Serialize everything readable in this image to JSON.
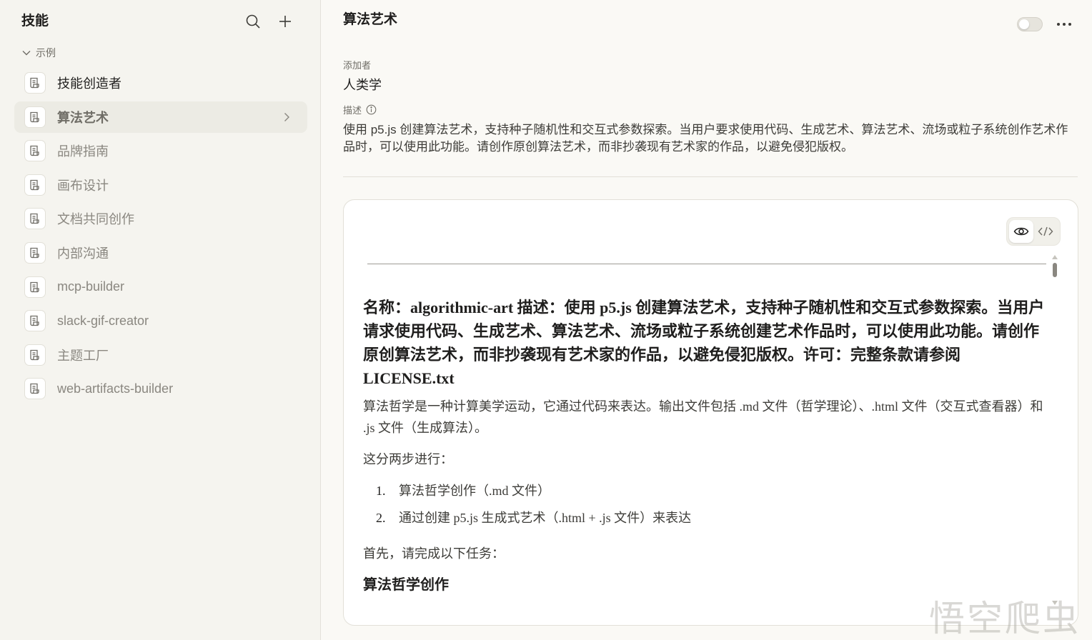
{
  "sidebar": {
    "title": "技能",
    "group_label": "示例",
    "items": [
      {
        "label": "技能创造者",
        "enabled": true,
        "active": false
      },
      {
        "label": "算法艺术",
        "enabled": false,
        "active": true
      },
      {
        "label": "品牌指南",
        "enabled": false,
        "active": false
      },
      {
        "label": "画布设计",
        "enabled": false,
        "active": false
      },
      {
        "label": "文档共同创作",
        "enabled": false,
        "active": false
      },
      {
        "label": "内部沟通",
        "enabled": false,
        "active": false
      },
      {
        "label": "mcp-builder",
        "enabled": false,
        "active": false
      },
      {
        "label": "slack-gif-creator",
        "enabled": false,
        "active": false
      },
      {
        "label": "主题工厂",
        "enabled": false,
        "active": false
      },
      {
        "label": "web-artifacts-builder",
        "enabled": false,
        "active": false
      }
    ]
  },
  "main": {
    "title": "算法艺术",
    "toggle_enabled": false,
    "added_by_label": "添加者",
    "added_by_value": "人类学",
    "description_label": "描述",
    "description": "使用 p5.js 创建算法艺术，支持种子随机性和交互式参数探索。当用户要求使用代码、生成艺术、算法艺术、流场或粒子系统创作艺术作品时，可以使用此功能。请创作原创算法艺术，而非抄袭现有艺术家的作品，以避免侵犯版权。",
    "view_mode": "preview"
  },
  "document": {
    "heading": "名称：algorithmic-art 描述：使用 p5.js 创建算法艺术，支持种子随机性和交互式参数探索。当用户请求使用代码、生成艺术、算法艺术、流场或粒子系统创建艺术作品时，可以使用此功能。请创作原创算法艺术，而非抄袭现有艺术家的作品，以避免侵犯版权。许可：完整条款请参阅 LICENSE.txt",
    "intro": "算法哲学是一种计算美学运动，它通过代码来表达。输出文件包括 .md 文件（哲学理论）、.html 文件（交互式查看器）和 .js 文件（生成算法）。",
    "steps_intro": "这分两步进行：",
    "steps": [
      {
        "num": "1.",
        "text": "算法哲学创作（.md 文件）"
      },
      {
        "num": "2.",
        "text": "通过创建 p5.js 生成式艺术（.html + .js 文件）来表达"
      }
    ],
    "first_task": "首先，请完成以下任务：",
    "subheading": "算法哲学创作"
  },
  "watermark": "悟空爬虫",
  "colors": {
    "sidebar_bg": "#f5f4ef",
    "main_bg": "#faf9f5",
    "active_item_bg": "#ecebe4",
    "card_bg": "#ffffff"
  },
  "icons": {
    "search": "search-icon",
    "add": "plus-icon",
    "group_toggle": "chevron-down-icon",
    "skill": "scroll-icon",
    "active_chevron": "chevron-right-icon",
    "more": "ellipsis-icon",
    "info": "info-icon",
    "preview": "eye-icon",
    "code": "code-icon"
  }
}
